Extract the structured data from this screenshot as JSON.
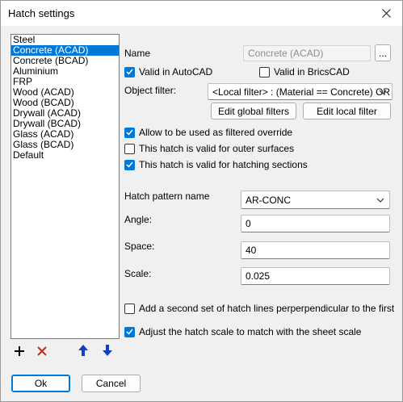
{
  "window": {
    "title": "Hatch settings"
  },
  "hatch_list": {
    "items": [
      "Steel",
      "Concrete (ACAD)",
      "Concrete (BCAD)",
      "Aluminium",
      "FRP",
      "Wood (ACAD)",
      "Wood (BCAD)",
      "Drywall (ACAD)",
      "Drywall (BCAD)",
      "Glass (ACAD)",
      "Glass (BCAD)",
      "Default"
    ],
    "selected": "Concrete (ACAD)"
  },
  "name": {
    "label": "Name",
    "value": "Concrete (ACAD)",
    "browse_label": "..."
  },
  "valid_autocad": {
    "label": "Valid in AutoCAD",
    "checked": true
  },
  "valid_bricscad": {
    "label": "Valid in BricsCAD",
    "checked": false
  },
  "object_filter": {
    "label": "Object filter:",
    "value": "<Local filter> : (Material == Concrete) OR",
    "edit_global_label": "Edit global filters",
    "edit_local_label": "Edit local filter"
  },
  "options": {
    "filtered_override": {
      "label": "Allow to be used as filtered override",
      "checked": true
    },
    "outer_surfaces": {
      "label": "This hatch is valid for outer surfaces",
      "checked": false
    },
    "hatching_sections": {
      "label": "This hatch is valid for hatching sections",
      "checked": true
    }
  },
  "pattern": {
    "label": "Hatch pattern name",
    "value": "AR-CONC"
  },
  "angle": {
    "label": "Angle:",
    "value": "0"
  },
  "space": {
    "label": "Space:",
    "value": "40"
  },
  "scale": {
    "label": "Scale:",
    "value": "0.025"
  },
  "second_set": {
    "label": "Add a second set of hatch lines perperpendicular to the first",
    "checked": false
  },
  "sheet_scale": {
    "label": "Adjust the hatch scale to match with the sheet scale",
    "checked": true
  },
  "footer": {
    "ok_label": "Ok",
    "cancel_label": "Cancel"
  },
  "colors": {
    "accent": "#0078d7",
    "delete_red": "#c42b1c",
    "arrow_blue": "#1040c8"
  }
}
